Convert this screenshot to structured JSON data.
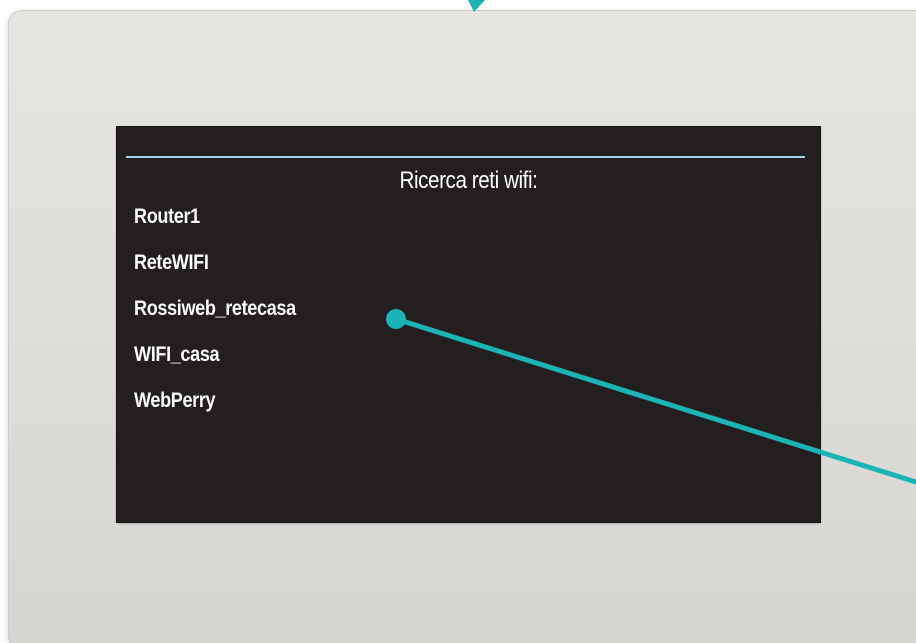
{
  "screen": {
    "title": "Ricerca reti wifi:",
    "networks": [
      {
        "ssid": "Router1"
      },
      {
        "ssid": "ReteWIFI"
      },
      {
        "ssid": "Rossiweb_retecasa"
      },
      {
        "ssid": "WIFI_casa"
      },
      {
        "ssid": "WebPerry"
      }
    ]
  },
  "colors": {
    "panel": "#e2e0dc",
    "screen_background": "#231f20",
    "accent_line": "#9fd3e4",
    "text": "#ffffff",
    "callout": "#1bb3b5"
  }
}
